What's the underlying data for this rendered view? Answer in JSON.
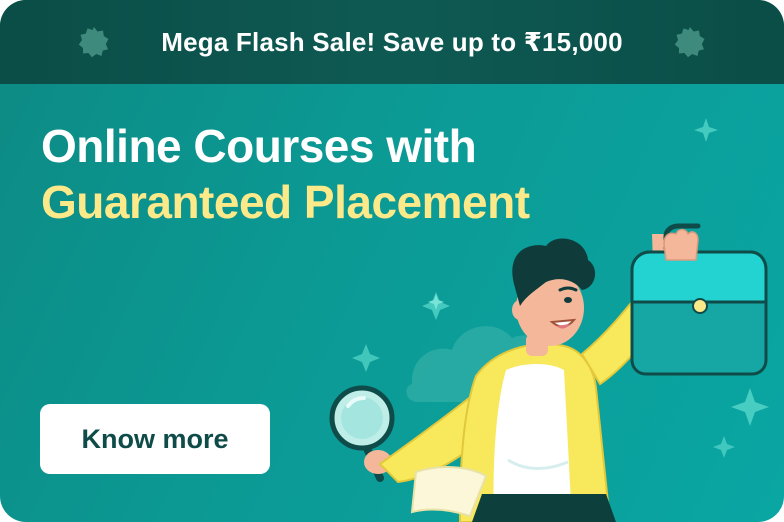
{
  "banner": {
    "sale_text": "Mega Flash Sale! Save up to ₹15,000"
  },
  "hero": {
    "headline_line1": "Online Courses with",
    "headline_line2": "Guaranteed Placement",
    "cta_label": "Know more"
  },
  "colors": {
    "background_teal": "#0c9a95",
    "banner_dark": "#0b4d47",
    "highlight_yellow": "#fbe98a",
    "button_text": "#0f4c49"
  },
  "icons": {
    "left_badge": "badge-icon",
    "right_badge": "badge-icon",
    "illustration": "person-with-briefcase-and-magnifier"
  }
}
